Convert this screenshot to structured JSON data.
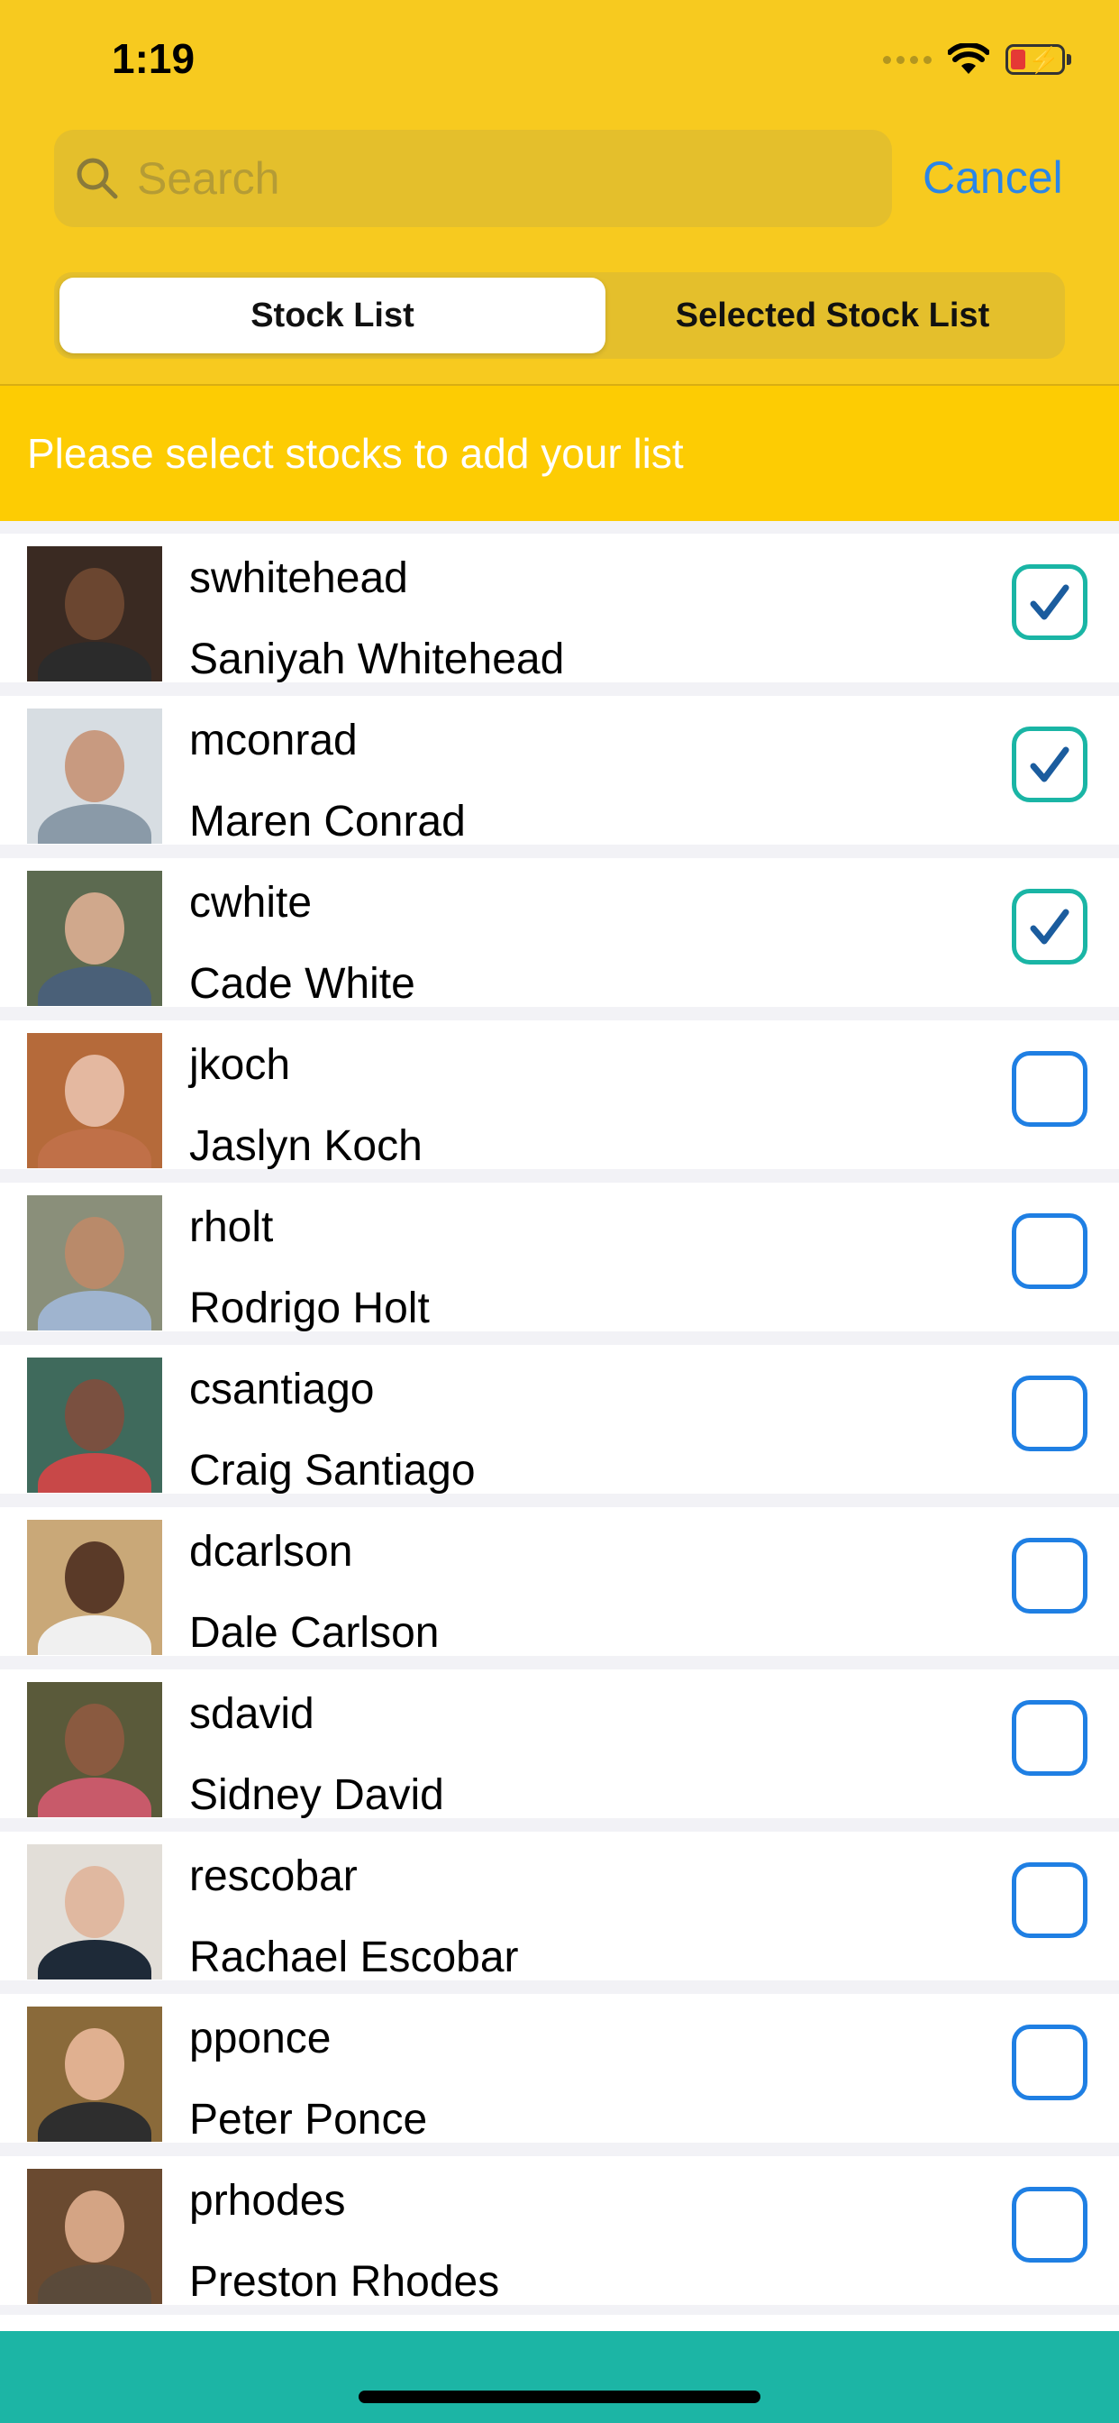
{
  "status_bar": {
    "time": "1:19"
  },
  "search": {
    "placeholder": "Search",
    "cancel_label": "Cancel"
  },
  "tabs": [
    {
      "label": "Stock List",
      "active": true
    },
    {
      "label": "Selected Stock List",
      "active": false
    }
  ],
  "banner": {
    "text": "Please select stocks to add your list"
  },
  "colors": {
    "header": "#f7ca1f",
    "banner": "#fdcc03",
    "checked_border": "#1ab5a5",
    "check_mark": "#1b5c9e",
    "unchecked_border": "#1f7fe3",
    "bottom_bar": "#1cb5a5",
    "cancel": "#2a86e8"
  },
  "rows": [
    {
      "username": "swhitehead",
      "name": "Saniyah Whitehead",
      "checked": true
    },
    {
      "username": "mconrad",
      "name": "Maren Conrad",
      "checked": true
    },
    {
      "username": "cwhite",
      "name": "Cade White",
      "checked": true
    },
    {
      "username": "jkoch",
      "name": "Jaslyn Koch",
      "checked": false
    },
    {
      "username": "rholt",
      "name": "Rodrigo Holt",
      "checked": false
    },
    {
      "username": "csantiago",
      "name": "Craig Santiago",
      "checked": false
    },
    {
      "username": "dcarlson",
      "name": "Dale Carlson",
      "checked": false
    },
    {
      "username": "sdavid",
      "name": "Sidney David",
      "checked": false
    },
    {
      "username": "rescobar",
      "name": "Rachael Escobar",
      "checked": false
    },
    {
      "username": "pponce",
      "name": "Peter Ponce",
      "checked": false
    },
    {
      "username": "prhodes",
      "name": "Preston Rhodes",
      "checked": false
    }
  ]
}
